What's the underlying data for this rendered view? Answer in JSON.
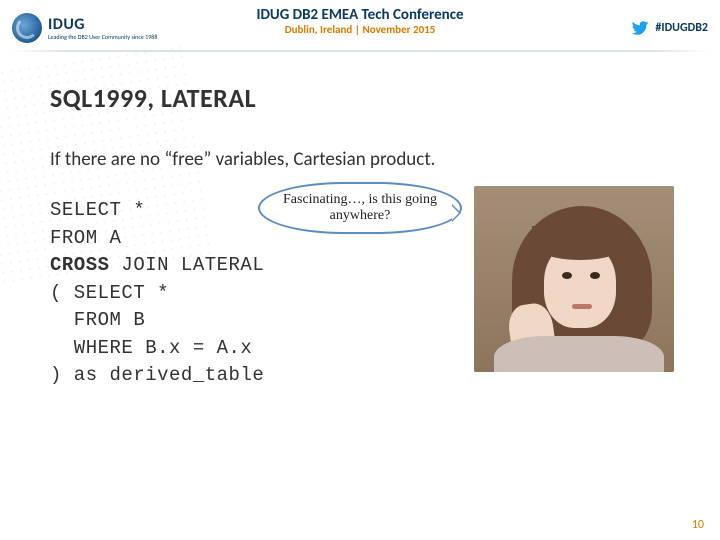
{
  "header": {
    "logo_text": "IDUG",
    "logo_sub": "Leading the DB2 User Community since 1988",
    "conf_title": "IDUG DB2 EMEA Tech Conference",
    "conf_sub": "Dublin, Ireland | November 2015",
    "hashtag": "#IDUGDB2"
  },
  "slide": {
    "title": "SQL1999, LATERAL",
    "lead": "If there are no “free” variables, Cartesian product.",
    "bubble": "Fascinating…, is this going anywhere?",
    "code_lines": [
      "SELECT *",
      "FROM A",
      "CROSS JOIN LATERAL",
      "( SELECT *",
      "  FROM B",
      "  WHERE B.x = A.x",
      ") as derived_table"
    ],
    "cross_keyword": "CROSS",
    "page_number": "10"
  },
  "icons": {
    "twitter": "twitter-bird-icon",
    "logo": "idug-globe-icon"
  }
}
